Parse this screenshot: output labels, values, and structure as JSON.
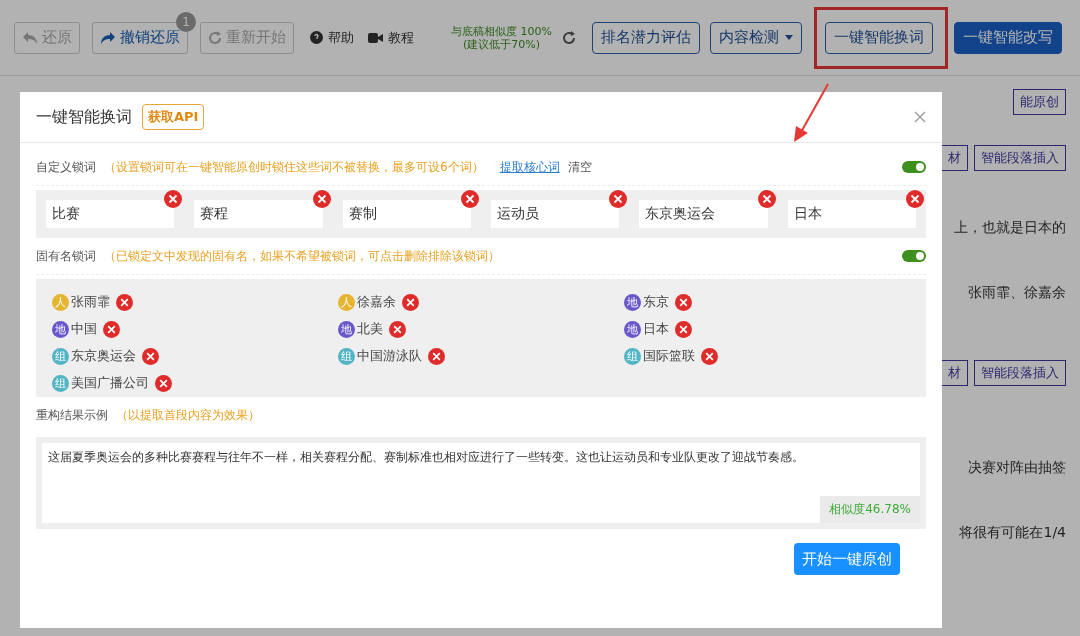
{
  "toolbar": {
    "actions": [
      {
        "label": "还原",
        "disabled": true
      },
      {
        "label": "撤销还原",
        "disabled": false,
        "badge": "1"
      },
      {
        "label": "重新开始",
        "disabled": true
      }
    ],
    "links": [
      {
        "label": "帮助"
      },
      {
        "label": "教程"
      }
    ],
    "similarity": [
      "与底稿相似度 100%",
      "(建议低于70%)"
    ],
    "buttons": [
      {
        "label": "排名潜力评估",
        "kind": "outline",
        "highlighted": false
      },
      {
        "label": "内容检测",
        "kind": "dropdown",
        "highlighted": false
      },
      {
        "label": "一键智能换词",
        "kind": "outline",
        "highlighted": true
      },
      {
        "label": "一键智能改写",
        "kind": "primary",
        "highlighted": false
      }
    ]
  },
  "page_behind": [
    {
      "items": [
        {
          "kind": "tag",
          "text": "能原创"
        }
      ]
    },
    {
      "items": [
        {
          "kind": "tag",
          "text": "材"
        },
        {
          "kind": "tag",
          "text": "智能段落插入"
        }
      ]
    },
    {
      "items": [
        {
          "kind": "text",
          "text": "上，也就是日本的"
        }
      ]
    },
    {
      "items": [
        {
          "kind": "text",
          "text": "张雨霏、徐嘉余"
        }
      ]
    },
    {
      "items": [
        {
          "kind": "tag",
          "text": "材"
        },
        {
          "kind": "tag",
          "text": "智能段落插入"
        }
      ]
    },
    {
      "items": [
        {
          "kind": "text",
          "text": "决赛对阵由抽签"
        }
      ]
    },
    {
      "items": [
        {
          "kind": "text",
          "text": "将很有可能在1/4"
        }
      ]
    }
  ],
  "modal": {
    "title": "一键智能换词",
    "api_badge": "获取API",
    "custom_lock": {
      "label": "自定义锁词",
      "hint": "（设置锁词可在一键智能原创时锁住这些词不被替换，最多可设6个词）",
      "extract_link": "提取核心词",
      "clear_link": "清空",
      "on": true,
      "words": [
        "比赛",
        "赛程",
        "赛制",
        "运动员",
        "东京奥运会",
        "日本"
      ]
    },
    "proper_lock": {
      "label": "固有名锁词",
      "hint": "（已锁定文中发现的固有名，如果不希望被锁词，可点击删除排除该锁词）",
      "on": true,
      "names": [
        {
          "name": "张雨霏",
          "kind": "person",
          "badge": "人"
        },
        {
          "name": "徐嘉余",
          "kind": "person",
          "badge": "人"
        },
        {
          "name": "东京",
          "kind": "place",
          "badge": "地"
        },
        {
          "name": "中国",
          "kind": "place",
          "badge": "地"
        },
        {
          "name": "北美",
          "kind": "place",
          "badge": "地"
        },
        {
          "name": "日本",
          "kind": "place",
          "badge": "地"
        },
        {
          "name": "东京奥运会",
          "kind": "org",
          "badge": "组"
        },
        {
          "name": "中国游泳队",
          "kind": "org",
          "badge": "组"
        },
        {
          "name": "国际篮联",
          "kind": "org",
          "badge": "组"
        },
        {
          "name": "美国广播公司",
          "kind": "org",
          "badge": "组"
        }
      ]
    },
    "result": {
      "label": "重构结果示例",
      "hint": "（以提取首段内容为效果）",
      "text": "这届夏季奥运会的多种比赛赛程与往年不一样，相关赛程分配、赛制标准也相对应进行了一些转变。这也让运动员和专业队更改了迎战节奏感。",
      "similarity": "相似度46.78%"
    },
    "start_button": "开始一键原创"
  }
}
